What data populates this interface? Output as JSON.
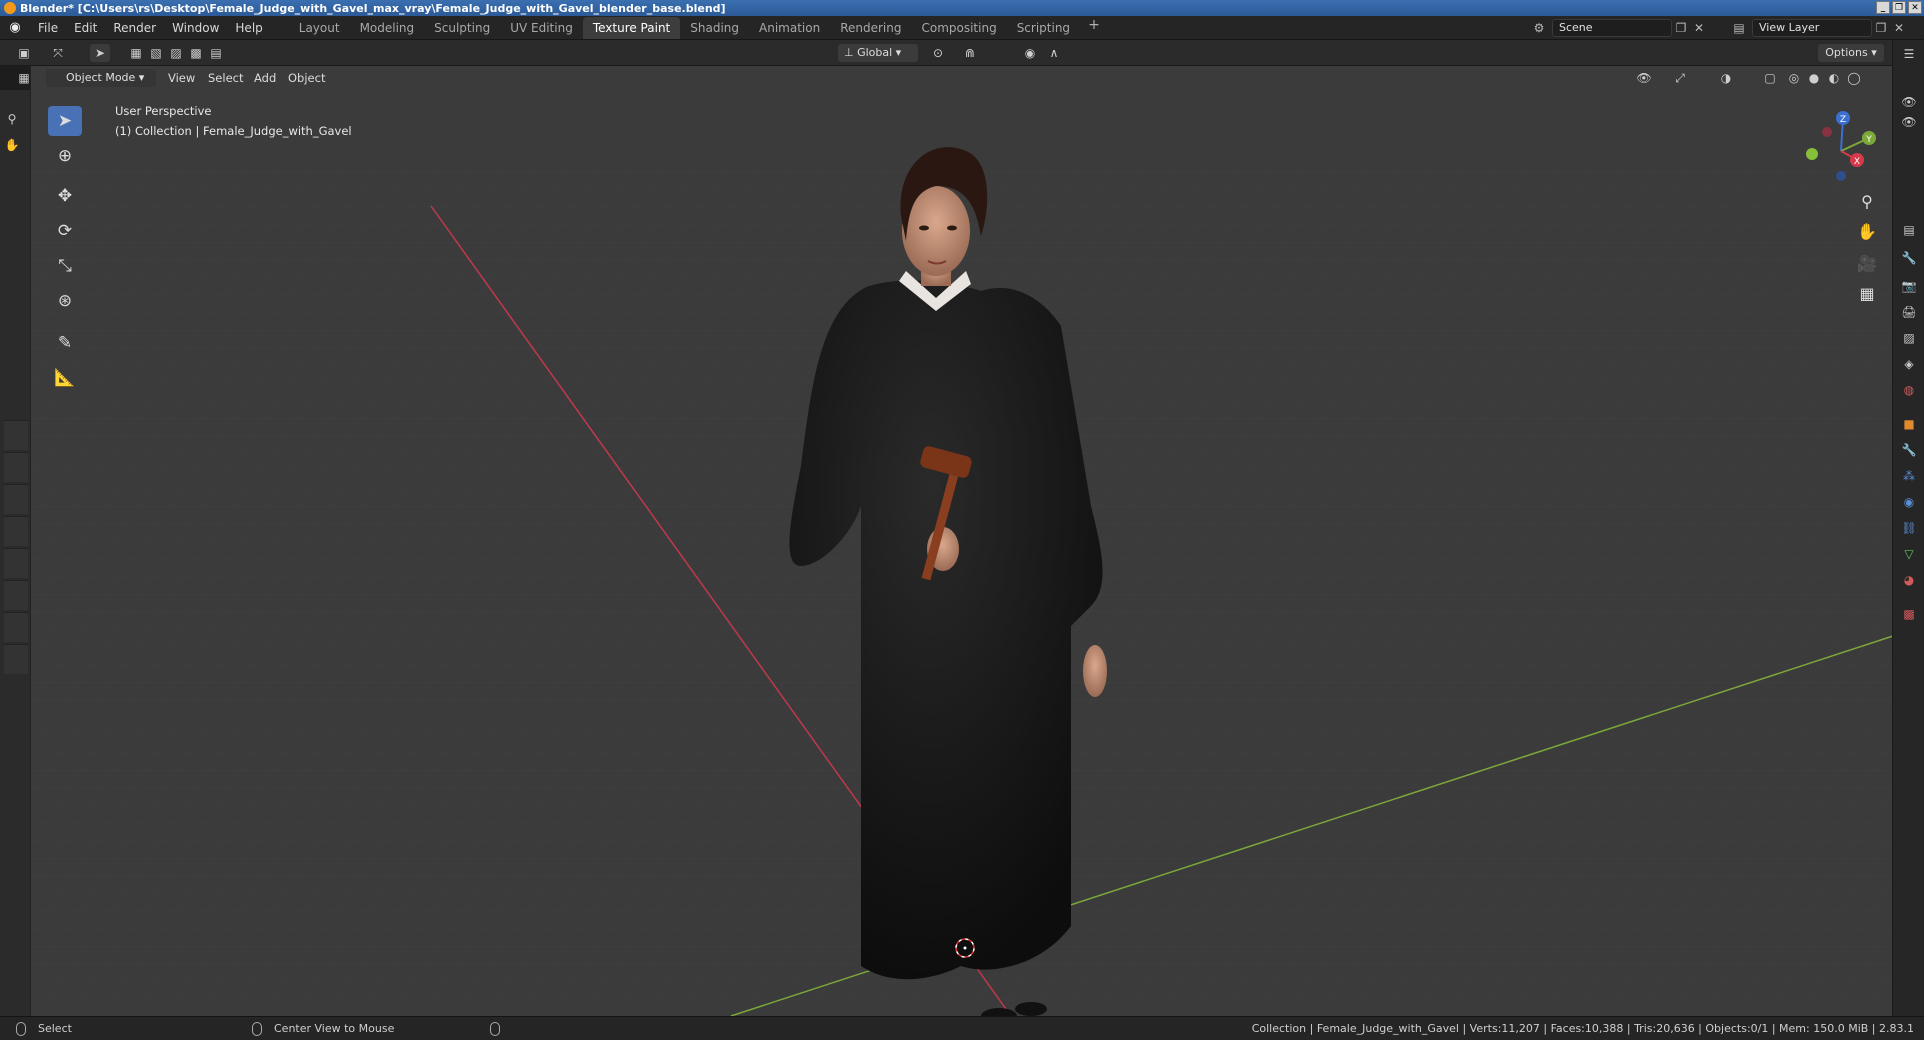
{
  "window": {
    "title": "Blender* [C:\\Users\\rs\\Desktop\\Female_Judge_with_Gavel_max_vray\\Female_Judge_with_Gavel_blender_base.blend]"
  },
  "menu": [
    "File",
    "Edit",
    "Render",
    "Window",
    "Help"
  ],
  "workspaces": [
    "Layout",
    "Modeling",
    "Sculpting",
    "UV Editing",
    "Texture Paint",
    "Shading",
    "Animation",
    "Rendering",
    "Compositing",
    "Scripting"
  ],
  "active_workspace": "Texture Paint",
  "scene": {
    "name": "Scene"
  },
  "view_layer": {
    "name": "View Layer"
  },
  "toolheader": {
    "orientation": "Global",
    "options_label": "Options"
  },
  "viewport_header": {
    "mode": "Object Mode",
    "menus": [
      "View",
      "Select",
      "Add",
      "Object"
    ]
  },
  "viewport": {
    "perspective_label": "User Perspective",
    "collection_label": "(1) Collection | Female_Judge_with_Gavel"
  },
  "statusbar": {
    "left_action": "Select",
    "middle_action": "Center View to Mouse",
    "stats": "Collection | Female_Judge_with_Gavel | Verts:11,207 | Faces:10,388 | Tris:20,636 | Objects:0/1 | Mem: 150.0 MiB | 2.83.1"
  },
  "colors": {
    "accent_blue": "#4872b5",
    "viewport_bg": "#3b3b3b",
    "axis_x": "#c0394b",
    "axis_y": "#7ca83a"
  },
  "icons": {
    "gizmo_axes": [
      "Z",
      "Y",
      "X"
    ]
  }
}
